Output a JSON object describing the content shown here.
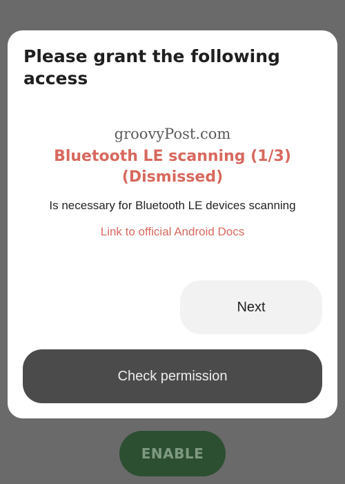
{
  "background": {
    "enable_label": "ENABLE"
  },
  "dialog": {
    "title": "Please grant the following access",
    "watermark": "groovyPost.com",
    "permission_title": "Bluetooth LE scanning (1/3) (Dismissed)",
    "permission_description": "Is necessary for Bluetooth LE devices scanning",
    "docs_link": "Link to official Android Docs",
    "next_label": "Next",
    "check_permission_label": "Check permission"
  },
  "colors": {
    "scrim": "#6a6a6a",
    "accent": "#d8685e",
    "enable_button": "#2c4f32",
    "check_button": "#4b4b4b",
    "next_button": "#f2f2f2"
  }
}
